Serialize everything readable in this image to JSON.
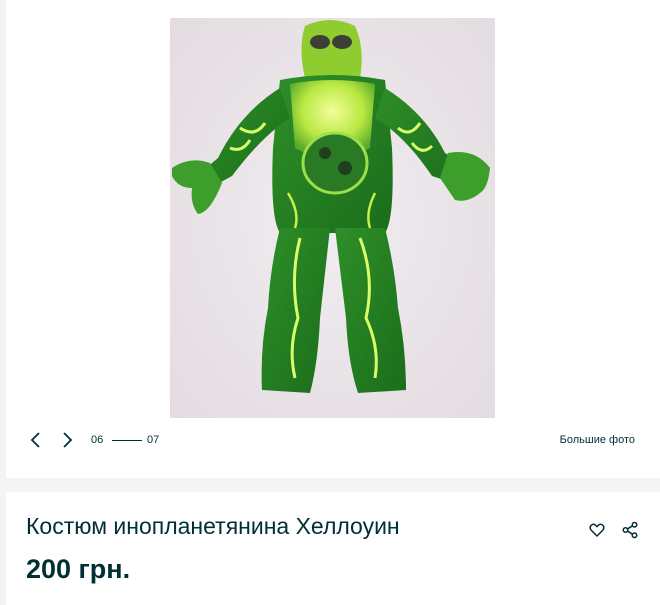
{
  "gallery": {
    "photo_alt": "Костюм инопланетянина Хеллоуин",
    "current_index": "06",
    "total_count": "07",
    "big_photos_label": "Большие фото",
    "icons": {
      "prev": "chevron-left-icon",
      "next": "chevron-right-icon"
    }
  },
  "listing": {
    "title": "Костюм инопланетянина Хеллоуин",
    "price": "200 грн.",
    "icons": {
      "favorite": "heart-icon",
      "share": "share-icon"
    }
  },
  "colors": {
    "text": "#002f34",
    "page_background": "#f2f4f5",
    "card_background": "#ffffff",
    "costume_dark_green": "#1f7a1f",
    "costume_light_green": "#c8f04a"
  }
}
